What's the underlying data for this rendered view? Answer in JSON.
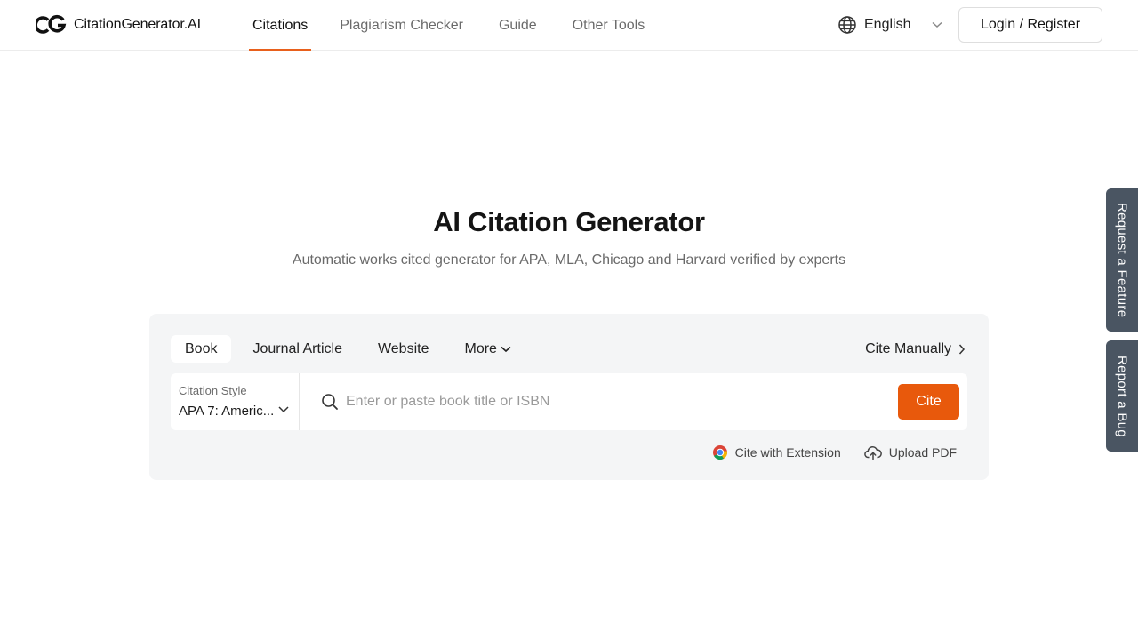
{
  "brand": {
    "name": "CitationGenerator.AI",
    "accent": "#e8601c"
  },
  "nav": {
    "items": [
      {
        "label": "Citations",
        "active": true
      },
      {
        "label": "Plagiarism Checker",
        "active": false
      },
      {
        "label": "Guide",
        "active": false
      },
      {
        "label": "Other Tools",
        "active": false
      }
    ]
  },
  "header": {
    "language": "English",
    "login_label": "Login / Register"
  },
  "hero": {
    "title": "AI Citation Generator",
    "subtitle": "Automatic works cited generator for APA, MLA, Chicago and Harvard verified by experts"
  },
  "card": {
    "tabs": [
      {
        "label": "Book",
        "active": true
      },
      {
        "label": "Journal Article",
        "active": false
      },
      {
        "label": "Website",
        "active": false
      },
      {
        "label": "More",
        "active": false
      }
    ],
    "cite_manually": "Cite Manually",
    "citation_style_label": "Citation Style",
    "citation_style_value": "APA 7: Americ...",
    "search_placeholder": "Enter or paste book title or ISBN",
    "search_value": "",
    "cite_button": "Cite",
    "cite_button_color": "#e8590c",
    "extension_label": "Cite with Extension",
    "upload_label": "Upload PDF"
  },
  "side_tabs": {
    "feature": "Request a Feature",
    "bug": "Report a Bug",
    "color": "#4a5562"
  },
  "icons": {
    "logo": "cg-logo-icon",
    "language": "globe-icon",
    "search": "search-icon",
    "extension": "chrome-icon",
    "upload": "cloud-upload-icon"
  }
}
